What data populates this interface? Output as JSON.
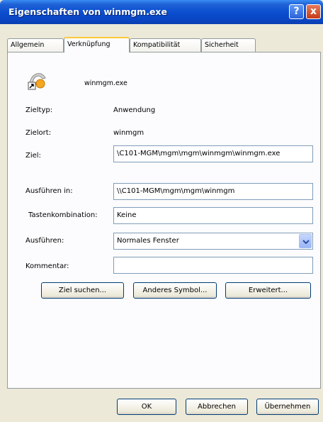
{
  "window": {
    "title": "Eigenschaften von winmgm.exe",
    "help_label": "?",
    "close_label": "x"
  },
  "tabs": [
    {
      "label": "Allgemein",
      "active": false
    },
    {
      "label": "Verknüpfung",
      "active": true
    },
    {
      "label": "Kompatibilität",
      "active": false
    },
    {
      "label": "Sicherheit",
      "active": false
    }
  ],
  "shortcut": {
    "file_name": "winmgm.exe",
    "zieltyp_label": "Zieltyp:",
    "zieltyp_value": "Anwendung",
    "zielort_label": "Zielort:",
    "zielort_value": "winmgm",
    "ziel_label": "Ziel:",
    "ziel_value": "\\C101-MGM\\mgm\\mgm\\winmgm\\winmgm.exe",
    "ausfuehren_in_label": "Ausführen in:",
    "ausfuehren_in_value": "\\\\C101-MGM\\mgm\\mgm\\winmgm",
    "tastenkombination_label": "Tastenkombination:",
    "tastenkombination_value": "Keine",
    "ausfuehren_label": "Ausführen:",
    "ausfuehren_value": "Normales Fenster",
    "kommentar_label": "Kommentar:",
    "kommentar_value": ""
  },
  "buttons": {
    "ziel_suchen": "Ziel suchen...",
    "anderes_symbol": "Anderes Symbol...",
    "erweitert": "Erweitert...",
    "ok": "OK",
    "abbrechen": "Abbrechen",
    "uebernehmen": "Übernehmen"
  },
  "colors": {
    "titlebar": "#0a4fd0",
    "dialog_bg": "#ece9d8",
    "active_tab_accent": "#ffc83c"
  },
  "icons": {
    "app": "shortcut-application-icon",
    "dropdown": "chevron-down-icon"
  }
}
